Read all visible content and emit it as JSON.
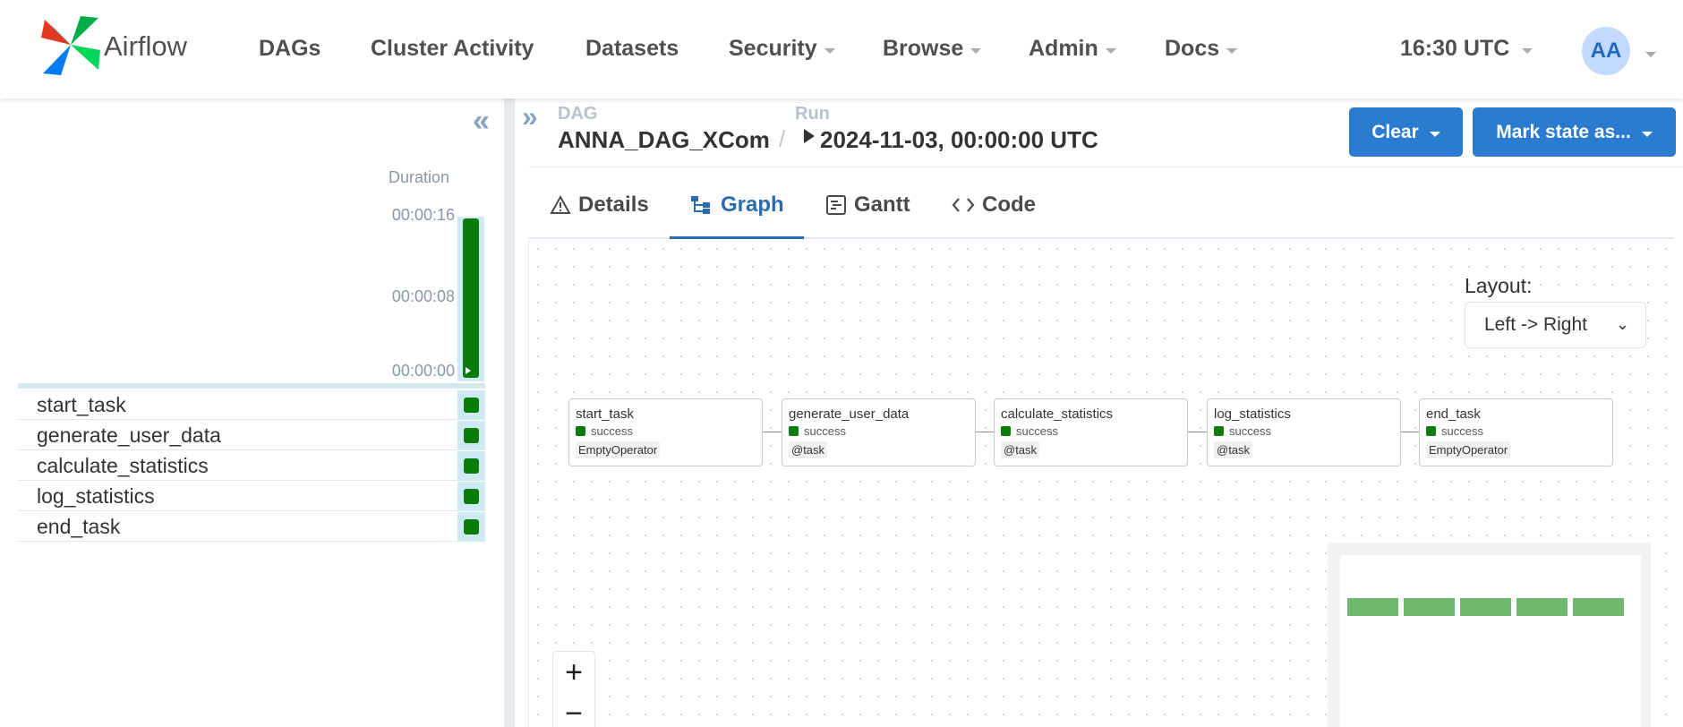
{
  "app": {
    "name": "Airflow"
  },
  "nav": {
    "items": [
      {
        "label": "DAGs",
        "dropdown": false
      },
      {
        "label": "Cluster Activity",
        "dropdown": false
      },
      {
        "label": "Datasets",
        "dropdown": false
      },
      {
        "label": "Security",
        "dropdown": true
      },
      {
        "label": "Browse",
        "dropdown": true
      },
      {
        "label": "Admin",
        "dropdown": true
      },
      {
        "label": "Docs",
        "dropdown": true
      }
    ],
    "time": "16:30 UTC",
    "user_initials": "AA"
  },
  "grid": {
    "duration_title": "Duration",
    "ticks": [
      "00:00:16",
      "00:00:08",
      "00:00:00"
    ],
    "tasks": [
      {
        "name": "start_task",
        "state": "success"
      },
      {
        "name": "generate_user_data",
        "state": "success"
      },
      {
        "name": "calculate_statistics",
        "state": "success"
      },
      {
        "name": "log_statistics",
        "state": "success"
      },
      {
        "name": "end_task",
        "state": "success"
      }
    ]
  },
  "breadcrumb": {
    "dag_label": "DAG",
    "dag_value": "ANNA_DAG_XCom",
    "separator": "/",
    "run_label": "Run",
    "run_value": "2024-11-03, 00:00:00 UTC"
  },
  "actions": {
    "clear": "Clear",
    "mark_state": "Mark state as..."
  },
  "tabs": [
    {
      "label": "Details",
      "icon": "warning-icon",
      "active": false
    },
    {
      "label": "Graph",
      "icon": "graph-icon",
      "active": true
    },
    {
      "label": "Gantt",
      "icon": "gantt-icon",
      "active": false
    },
    {
      "label": "Code",
      "icon": "code-icon",
      "active": false
    }
  ],
  "graph": {
    "layout_label": "Layout:",
    "layout_value": "Left -> Right",
    "nodes": [
      {
        "title": "start_task",
        "state": "success",
        "operator": "EmptyOperator"
      },
      {
        "title": "generate_user_data",
        "state": "success",
        "operator": "@task"
      },
      {
        "title": "calculate_statistics",
        "state": "success",
        "operator": "@task"
      },
      {
        "title": "log_statistics",
        "state": "success",
        "operator": "@task"
      },
      {
        "title": "end_task",
        "state": "success",
        "operator": "EmptyOperator"
      }
    ],
    "zoom_in": "+",
    "zoom_out": "−"
  },
  "colors": {
    "success": "#0a7c0a",
    "primary": "#2b7bd0",
    "active_tab": "#2b6cb0"
  }
}
